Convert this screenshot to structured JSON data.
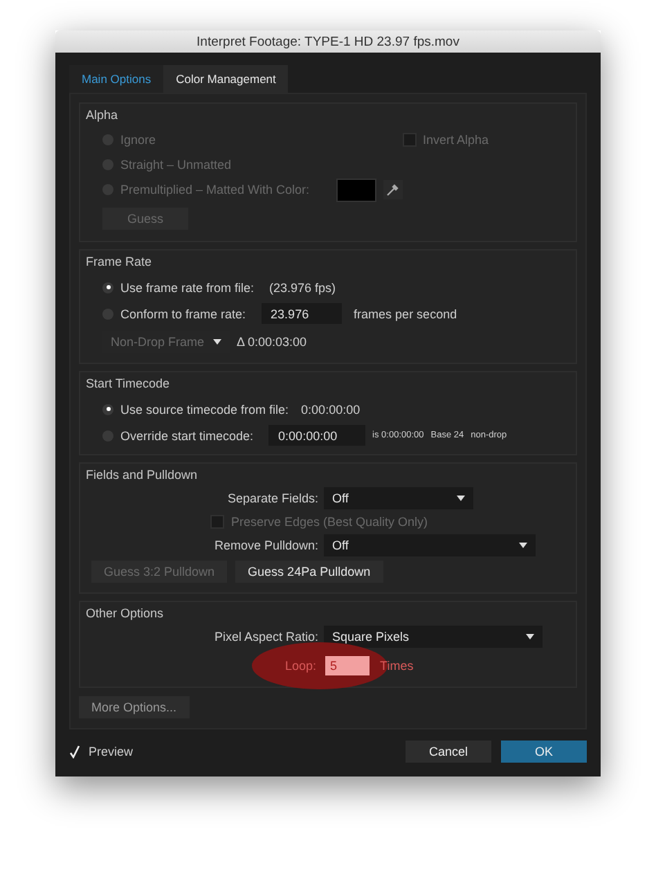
{
  "window": {
    "title": "Interpret Footage: TYPE-1 HD 23.97 fps.mov"
  },
  "tabs": [
    {
      "label": "Main Options",
      "selected": true
    },
    {
      "label": "Color Management",
      "selected": false
    }
  ],
  "alpha": {
    "title": "Alpha",
    "disabled": true,
    "options": [
      {
        "label": "Ignore",
        "selected": false
      },
      {
        "label": "Straight – Unmatted",
        "selected": false
      },
      {
        "label": "Premultiplied – Matted With Color:",
        "selected": false
      }
    ],
    "invert_alpha": {
      "label": "Invert Alpha",
      "checked": false
    },
    "matte_swatch": {
      "color": "#000000"
    },
    "guess_button": "Guess"
  },
  "frame_rate": {
    "title": "Frame Rate",
    "options": [
      {
        "label": "Use frame rate from file:",
        "value": "(23.976 fps)",
        "selected": true
      },
      {
        "label": "Conform to frame rate:",
        "field": "23.976",
        "unit": "frames per second",
        "selected": false
      }
    ],
    "drop_frame": {
      "value": "Non-Drop Frame",
      "disabled": true
    },
    "duration": "Δ 0:00:03:00"
  },
  "start_timecode": {
    "title": "Start Timecode",
    "options": [
      {
        "label": "Use source timecode from file:",
        "value": "0:00:00:00",
        "selected": true
      },
      {
        "label": "Override start timecode:",
        "field": "0:00:00:00",
        "notes": [
          "is 0:00:00:00",
          "Base 24",
          "non-drop"
        ],
        "selected": false
      }
    ]
  },
  "fields_and_pulldown": {
    "title": "Fields and Pulldown",
    "separate_fields": {
      "label": "Separate Fields:",
      "value": "Off"
    },
    "preserve_edges": {
      "label": "Preserve Edges (Best Quality Only)",
      "checked": false,
      "disabled": true
    },
    "remove_pulldown": {
      "label": "Remove Pulldown:",
      "value": "Off"
    },
    "buttons": [
      {
        "label": "Guess 3:2 Pulldown",
        "disabled": true
      },
      {
        "label": "Guess 24Pa Pulldown",
        "disabled": false
      }
    ]
  },
  "other_options": {
    "title": "Other Options",
    "pixel_aspect_ratio": {
      "label": "Pixel Aspect Ratio:",
      "value": "Square Pixels"
    },
    "loop": {
      "label": "Loop:",
      "value": "5",
      "unit": "Times",
      "highlighted": true
    }
  },
  "more_options": "More Options...",
  "preview": {
    "label": "Preview",
    "checked": true
  },
  "buttons": [
    {
      "label": "Cancel",
      "kind": "secondary"
    },
    {
      "label": "OK",
      "kind": "primary"
    }
  ]
}
